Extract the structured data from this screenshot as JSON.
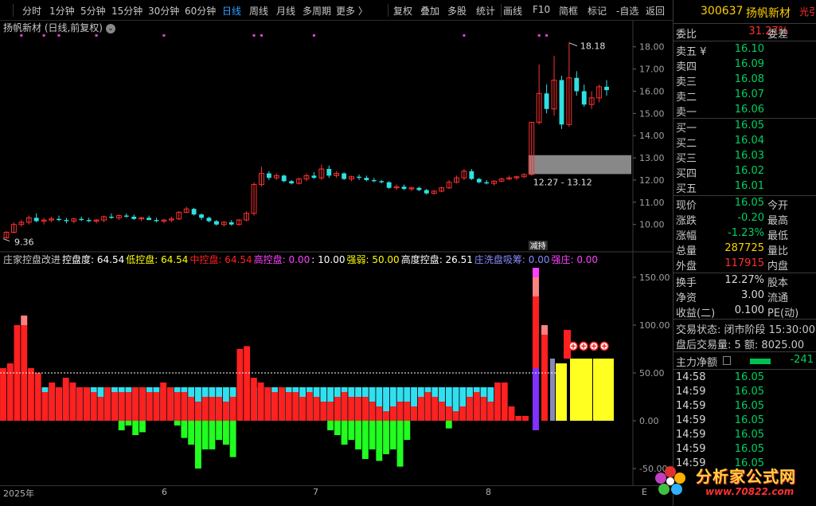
{
  "toolbar": {
    "items": [
      "分时",
      "1分钟",
      "5分钟",
      "15分钟",
      "30分钟",
      "60分钟",
      "日线",
      "周线",
      "月线",
      "多周期",
      "更多 〉",
      "复权",
      "叠加",
      "多股",
      "统计",
      "画线",
      "F10",
      "简框",
      "标记",
      "-自选",
      "返回"
    ],
    "active": "日线"
  },
  "main": {
    "title": "扬帆新材 (日线,前复权)",
    "circle_icon": "chevron-down-icon",
    "high_label": "18.18",
    "low_label": "9.36",
    "range_label": "12.27 - 13.12",
    "event_tag": "减持"
  },
  "indicator_legend": [
    {
      "text": "庄家控盘改进",
      "color": "#c8c8c8"
    },
    {
      "text": "控盘度: 64.54",
      "color": "#ffffff"
    },
    {
      "text": "低控盘: 64.54",
      "color": "#ffff00"
    },
    {
      "text": "中控盘: 64.54",
      "color": "#ff2020"
    },
    {
      "text": "高控盘: 0.00",
      "color": "#ff40ff"
    },
    {
      "text": ": 10.00",
      "color": "#ffffff"
    },
    {
      "text": "强弱: 50.00",
      "color": "#ffff00"
    },
    {
      "text": "高度控盘: 26.51",
      "color": "#ffffff"
    },
    {
      "text": "庄洗盘吸筹: 0.00",
      "color": "#8888ff"
    },
    {
      "text": "强庄: 0.00",
      "color": "#ff40ff"
    }
  ],
  "chart_data": [
    {
      "type": "candlestick",
      "title": "扬帆新材 (日线,前复权)",
      "yticks": [
        10,
        11,
        12,
        13,
        14,
        15,
        16,
        17,
        18
      ],
      "ylim": [
        9.2,
        18.6
      ],
      "candles": [
        [
          9.4,
          9.7,
          9.36,
          9.65
        ],
        [
          9.65,
          10.1,
          9.6,
          10.0
        ],
        [
          10.0,
          10.2,
          9.9,
          10.1
        ],
        [
          10.1,
          10.4,
          10.0,
          10.3
        ],
        [
          10.3,
          10.5,
          10.1,
          10.15
        ],
        [
          10.15,
          10.3,
          10.0,
          10.2
        ],
        [
          10.2,
          10.35,
          10.1,
          10.25
        ],
        [
          10.25,
          10.4,
          10.15,
          10.2
        ],
        [
          10.2,
          10.3,
          10.05,
          10.15
        ],
        [
          10.15,
          10.3,
          10.05,
          10.25
        ],
        [
          10.25,
          10.35,
          10.15,
          10.2
        ],
        [
          10.2,
          10.3,
          10.1,
          10.15
        ],
        [
          10.15,
          10.25,
          10.05,
          10.2
        ],
        [
          10.2,
          10.4,
          10.1,
          10.35
        ],
        [
          10.35,
          10.5,
          10.25,
          10.3
        ],
        [
          10.3,
          10.45,
          10.2,
          10.4
        ],
        [
          10.4,
          10.5,
          10.3,
          10.35
        ],
        [
          10.35,
          10.45,
          10.2,
          10.25
        ],
        [
          10.25,
          10.35,
          10.15,
          10.3
        ],
        [
          10.3,
          10.4,
          10.2,
          10.2
        ],
        [
          10.2,
          10.3,
          10.1,
          10.15
        ],
        [
          10.15,
          10.25,
          10.05,
          10.2
        ],
        [
          10.2,
          10.35,
          10.1,
          10.25
        ],
        [
          10.25,
          10.6,
          10.2,
          10.55
        ],
        [
          10.55,
          10.8,
          10.5,
          10.7
        ],
        [
          10.7,
          10.75,
          10.4,
          10.45
        ],
        [
          10.45,
          10.5,
          10.2,
          10.3
        ],
        [
          10.3,
          10.35,
          10.1,
          10.15
        ],
        [
          10.15,
          10.2,
          9.95,
          10.0
        ],
        [
          10.0,
          10.15,
          9.9,
          10.1
        ],
        [
          10.1,
          10.2,
          9.95,
          10.0
        ],
        [
          10.0,
          10.25,
          9.95,
          10.2
        ],
        [
          10.2,
          10.6,
          10.15,
          10.5
        ],
        [
          10.5,
          11.9,
          10.4,
          11.8
        ],
        [
          11.8,
          12.6,
          11.7,
          12.3
        ],
        [
          12.3,
          12.4,
          12.0,
          12.1
        ],
        [
          12.1,
          12.3,
          12.0,
          12.2
        ],
        [
          12.2,
          12.25,
          11.9,
          11.95
        ],
        [
          11.95,
          12.0,
          11.8,
          11.85
        ],
        [
          11.85,
          12.1,
          11.8,
          12.05
        ],
        [
          12.05,
          12.3,
          11.95,
          12.2
        ],
        [
          12.2,
          12.35,
          12.05,
          12.1
        ],
        [
          12.1,
          12.7,
          12.0,
          12.5
        ],
        [
          12.5,
          12.65,
          12.1,
          12.2
        ],
        [
          12.2,
          12.4,
          12.1,
          12.3
        ],
        [
          12.3,
          12.35,
          12.0,
          12.05
        ],
        [
          12.05,
          12.2,
          11.95,
          12.15
        ],
        [
          12.15,
          12.25,
          12.0,
          12.1
        ],
        [
          12.1,
          12.2,
          11.95,
          12.0
        ],
        [
          12.0,
          12.1,
          11.9,
          11.95
        ],
        [
          11.95,
          12.0,
          11.85,
          11.9
        ],
        [
          11.9,
          11.95,
          11.6,
          11.65
        ],
        [
          11.65,
          11.8,
          11.55,
          11.7
        ],
        [
          11.7,
          11.8,
          11.55,
          11.6
        ],
        [
          11.6,
          11.7,
          11.5,
          11.65
        ],
        [
          11.65,
          11.7,
          11.5,
          11.55
        ],
        [
          11.55,
          11.6,
          11.35,
          11.4
        ],
        [
          11.4,
          11.55,
          11.35,
          11.5
        ],
        [
          11.5,
          11.7,
          11.45,
          11.65
        ],
        [
          11.65,
          12.0,
          11.6,
          11.9
        ],
        [
          11.9,
          12.2,
          11.85,
          12.1
        ],
        [
          12.1,
          12.5,
          12.0,
          12.4
        ],
        [
          12.4,
          12.5,
          12.0,
          12.05
        ],
        [
          12.05,
          12.1,
          11.85,
          11.9
        ],
        [
          11.9,
          12.0,
          11.8,
          11.85
        ],
        [
          11.85,
          12.0,
          11.75,
          11.95
        ],
        [
          11.95,
          12.1,
          11.9,
          12.05
        ],
        [
          12.05,
          12.2,
          12.0,
          12.1
        ],
        [
          12.1,
          12.2,
          12.0,
          12.15
        ],
        [
          12.15,
          12.3,
          12.1,
          12.25
        ],
        [
          12.25,
          14.6,
          12.2,
          14.6
        ],
        [
          14.6,
          17.2,
          14.5,
          15.9
        ],
        [
          15.9,
          16.3,
          15.0,
          15.2
        ],
        [
          15.2,
          17.6,
          14.9,
          16.5
        ],
        [
          16.5,
          16.7,
          14.3,
          14.5
        ],
        [
          14.5,
          18.18,
          14.4,
          16.6
        ],
        [
          16.6,
          16.9,
          15.8,
          16.0
        ],
        [
          16.0,
          16.3,
          15.3,
          15.4
        ],
        [
          15.4,
          16.0,
          15.2,
          15.7
        ],
        [
          15.7,
          16.3,
          15.5,
          16.2
        ],
        [
          16.2,
          16.5,
          15.8,
          16.05
        ]
      ],
      "gray_zone": [
        12.27,
        13.12
      ],
      "marker_days": [
        2,
        5,
        7,
        12,
        21,
        33,
        34,
        41,
        61,
        71,
        72
      ]
    },
    {
      "type": "bar",
      "title": "庄家控盘改进",
      "yticks": [
        -50,
        0,
        50,
        100,
        150
      ],
      "ylim": [
        -65,
        160
      ],
      "dashed_line": 50,
      "red": [
        55,
        60,
        100,
        110,
        55,
        50,
        30,
        40,
        35,
        45,
        40,
        35,
        35,
        30,
        25,
        35,
        30,
        30,
        30,
        35,
        35,
        30,
        30,
        40,
        35,
        30,
        30,
        25,
        20,
        25,
        25,
        25,
        20,
        25,
        75,
        78,
        45,
        40,
        35,
        30,
        35,
        30,
        30,
        25,
        30,
        25,
        20,
        20,
        25,
        30,
        25,
        25,
        25,
        20,
        15,
        10,
        15,
        20,
        20,
        15,
        25,
        30,
        25,
        20,
        15,
        10,
        15,
        25,
        30,
        25,
        20,
        40,
        40,
        15,
        5,
        5
      ],
      "pink": [
        0,
        0,
        0,
        0,
        0,
        0,
        0,
        0,
        0,
        0,
        0,
        0,
        0,
        0,
        0,
        0,
        0,
        0,
        0,
        0,
        0,
        0,
        0,
        0,
        0,
        0,
        0,
        0,
        0,
        0,
        0,
        0,
        0,
        0,
        0,
        0,
        0,
        0,
        0,
        0,
        0,
        0,
        0,
        0,
        0,
        0,
        0,
        0,
        0,
        0,
        0,
        0,
        0,
        0,
        0,
        0,
        0,
        0,
        0,
        0,
        0,
        0,
        0,
        0,
        0,
        0,
        0,
        0,
        0,
        0,
        0,
        0,
        0,
        0,
        0,
        0
      ],
      "cyan": [
        0,
        0,
        0,
        0,
        0,
        0,
        35,
        35,
        35,
        35,
        35,
        35,
        35,
        35,
        35,
        35,
        35,
        35,
        35,
        35,
        35,
        35,
        35,
        35,
        35,
        35,
        35,
        35,
        35,
        35,
        35,
        35,
        35,
        35,
        0,
        0,
        35,
        35,
        35,
        35,
        35,
        35,
        35,
        35,
        35,
        35,
        35,
        35,
        35,
        35,
        35,
        35,
        35,
        35,
        35,
        35,
        35,
        35,
        35,
        35,
        35,
        35,
        35,
        35,
        35,
        35,
        35,
        35,
        35,
        35,
        35,
        0,
        0,
        0,
        0,
        0
      ],
      "green": [
        0,
        0,
        0,
        0,
        0,
        0,
        0,
        0,
        0,
        0,
        0,
        0,
        0,
        0,
        0,
        0,
        0,
        -10,
        -5,
        -15,
        -12,
        0,
        0,
        0,
        0,
        -5,
        -18,
        -25,
        -50,
        -30,
        -30,
        -20,
        -25,
        -38,
        0,
        0,
        0,
        0,
        0,
        0,
        0,
        0,
        0,
        0,
        0,
        0,
        0,
        -10,
        -15,
        -25,
        -20,
        -30,
        -40,
        -30,
        -42,
        -35,
        -30,
        -48,
        -20,
        0,
        0,
        0,
        0,
        0,
        -8,
        0,
        0,
        0,
        0,
        0,
        0,
        0,
        0,
        0,
        0,
        0
      ],
      "yellow": [
        0,
        0,
        0,
        0,
        0,
        0,
        0,
        0,
        0,
        0,
        0,
        0,
        0,
        0,
        0,
        0,
        0,
        0,
        0,
        0,
        0,
        0,
        0,
        0,
        0,
        0,
        0,
        0,
        0,
        0,
        0,
        0,
        0,
        0,
        0,
        0,
        0,
        0,
        0,
        0,
        0,
        0,
        0,
        0,
        0,
        0,
        0,
        0,
        0,
        0,
        0,
        0,
        0,
        0,
        0,
        0,
        0,
        0,
        0,
        0,
        0,
        0,
        0,
        0,
        0,
        0,
        0,
        0,
        0,
        0,
        0,
        0,
        0,
        0,
        0,
        0
      ],
      "tail": {
        "red_high": [
          150,
          100
        ],
        "yellow": [
          60,
          65,
          65,
          65,
          65
        ],
        "purple_min": -10,
        "gray": 65
      }
    }
  ],
  "bottom": {
    "year_label": "2025年",
    "month_labels": [
      "6",
      "7",
      "8"
    ],
    "right_tag": "E"
  },
  "panel": {
    "code": "300637",
    "name": "扬帆新材",
    "partial": "光引",
    "weibi_label": "委比",
    "weibi_value": "31.27%",
    "weicha_label": "委差",
    "asks": [
      {
        "label": "卖五 ¥",
        "price": "16.10"
      },
      {
        "label": "卖四",
        "price": "16.09"
      },
      {
        "label": "卖三",
        "price": "16.08"
      },
      {
        "label": "卖二",
        "price": "16.07"
      },
      {
        "label": "卖一",
        "price": "16.06"
      }
    ],
    "bids": [
      {
        "label": "买一",
        "price": "16.05"
      },
      {
        "label": "买二",
        "price": "16.04"
      },
      {
        "label": "买三",
        "price": "16.03"
      },
      {
        "label": "买四",
        "price": "16.02"
      },
      {
        "label": "买五",
        "price": "16.01"
      }
    ],
    "quote": [
      {
        "l1": "现价",
        "v1": "16.05",
        "c1": "g",
        "l2": "今开"
      },
      {
        "l1": "涨跌",
        "v1": "-0.20",
        "c1": "g",
        "l2": "最高"
      },
      {
        "l1": "涨幅",
        "v1": "-1.23%",
        "c1": "g",
        "l2": "最低"
      },
      {
        "l1": "总量",
        "v1": "287725",
        "c1": "y",
        "l2": "量比"
      },
      {
        "l1": "外盘",
        "v1": "117915",
        "c1": "r",
        "l2": "内盘"
      }
    ],
    "stats": [
      {
        "l1": "换手",
        "v1": "12.27%",
        "l2": "股本"
      },
      {
        "l1": "净资",
        "v1": "3.00",
        "l2": "流通"
      },
      {
        "l1": "收益(二)",
        "v1": "0.100",
        "l2": "PE(动)"
      }
    ],
    "trade_state": "交易状态: 闭市阶段 15:30:00",
    "after_hours": "盘后交易量: 5  额: 8025.00",
    "main_flow_label": "主力净额",
    "main_flow_value": "-241",
    "ticks": [
      {
        "time": "14:58",
        "price": "16.05"
      },
      {
        "time": "14:59",
        "price": "16.05"
      },
      {
        "time": "14:59",
        "price": "16.05"
      },
      {
        "time": "14:59",
        "price": "16.05"
      },
      {
        "time": "14:59",
        "price": "16.05"
      },
      {
        "time": "14:59",
        "price": "16.05"
      },
      {
        "time": "14:59",
        "price": "16.05"
      }
    ]
  },
  "watermark": {
    "text": "分析家公式网",
    "url": "www.70822.com"
  }
}
